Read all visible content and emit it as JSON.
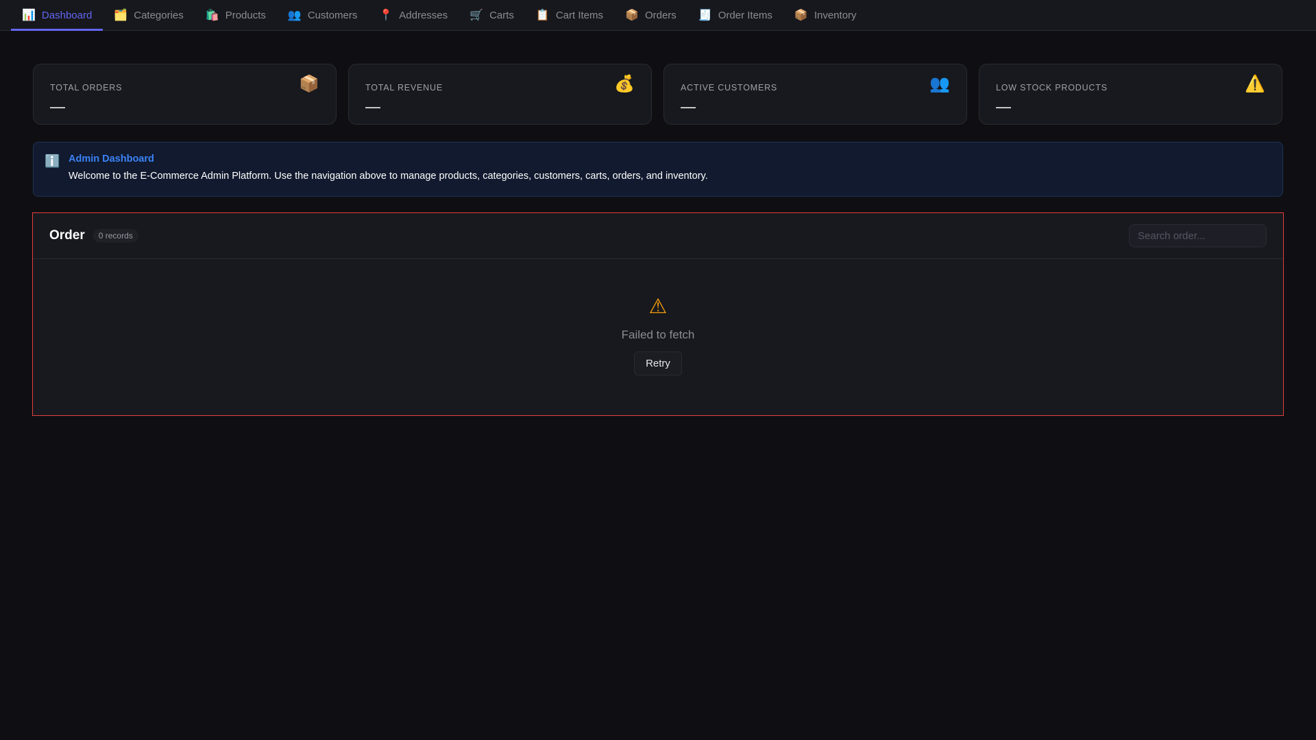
{
  "nav": {
    "tabs": [
      {
        "label": "Dashboard",
        "icon": "📊",
        "active": true
      },
      {
        "label": "Categories",
        "icon": "🗂️"
      },
      {
        "label": "Products",
        "icon": "🛍️"
      },
      {
        "label": "Customers",
        "icon": "👥"
      },
      {
        "label": "Addresses",
        "icon": "📍"
      },
      {
        "label": "Carts",
        "icon": "🛒"
      },
      {
        "label": "Cart Items",
        "icon": "📋"
      },
      {
        "label": "Orders",
        "icon": "📦"
      },
      {
        "label": "Order Items",
        "icon": "🧾"
      },
      {
        "label": "Inventory",
        "icon": "📦"
      }
    ]
  },
  "stats": [
    {
      "label": "TOTAL ORDERS",
      "value": "—",
      "icon": "📦"
    },
    {
      "label": "TOTAL REVENUE",
      "value": "—",
      "icon": "💰"
    },
    {
      "label": "ACTIVE CUSTOMERS",
      "value": "—",
      "icon": "👥"
    },
    {
      "label": "LOW STOCK PRODUCTS",
      "value": "—",
      "icon": "⚠️"
    }
  ],
  "banner": {
    "icon": "ℹ️",
    "title": "Admin Dashboard",
    "text": "Welcome to the E-Commerce Admin Platform. Use the navigation above to manage products, categories, customers, carts, orders, and inventory."
  },
  "panel": {
    "title": "Order",
    "records": "0 records",
    "search_placeholder": "Search order...",
    "error_icon": "⚠",
    "error": "Failed to fetch",
    "retry": "Retry"
  },
  "colors": {
    "accent": "#6366f1",
    "error_border": "#e53e3e",
    "info": "#3b82f6",
    "warning": "#f59e0b"
  }
}
